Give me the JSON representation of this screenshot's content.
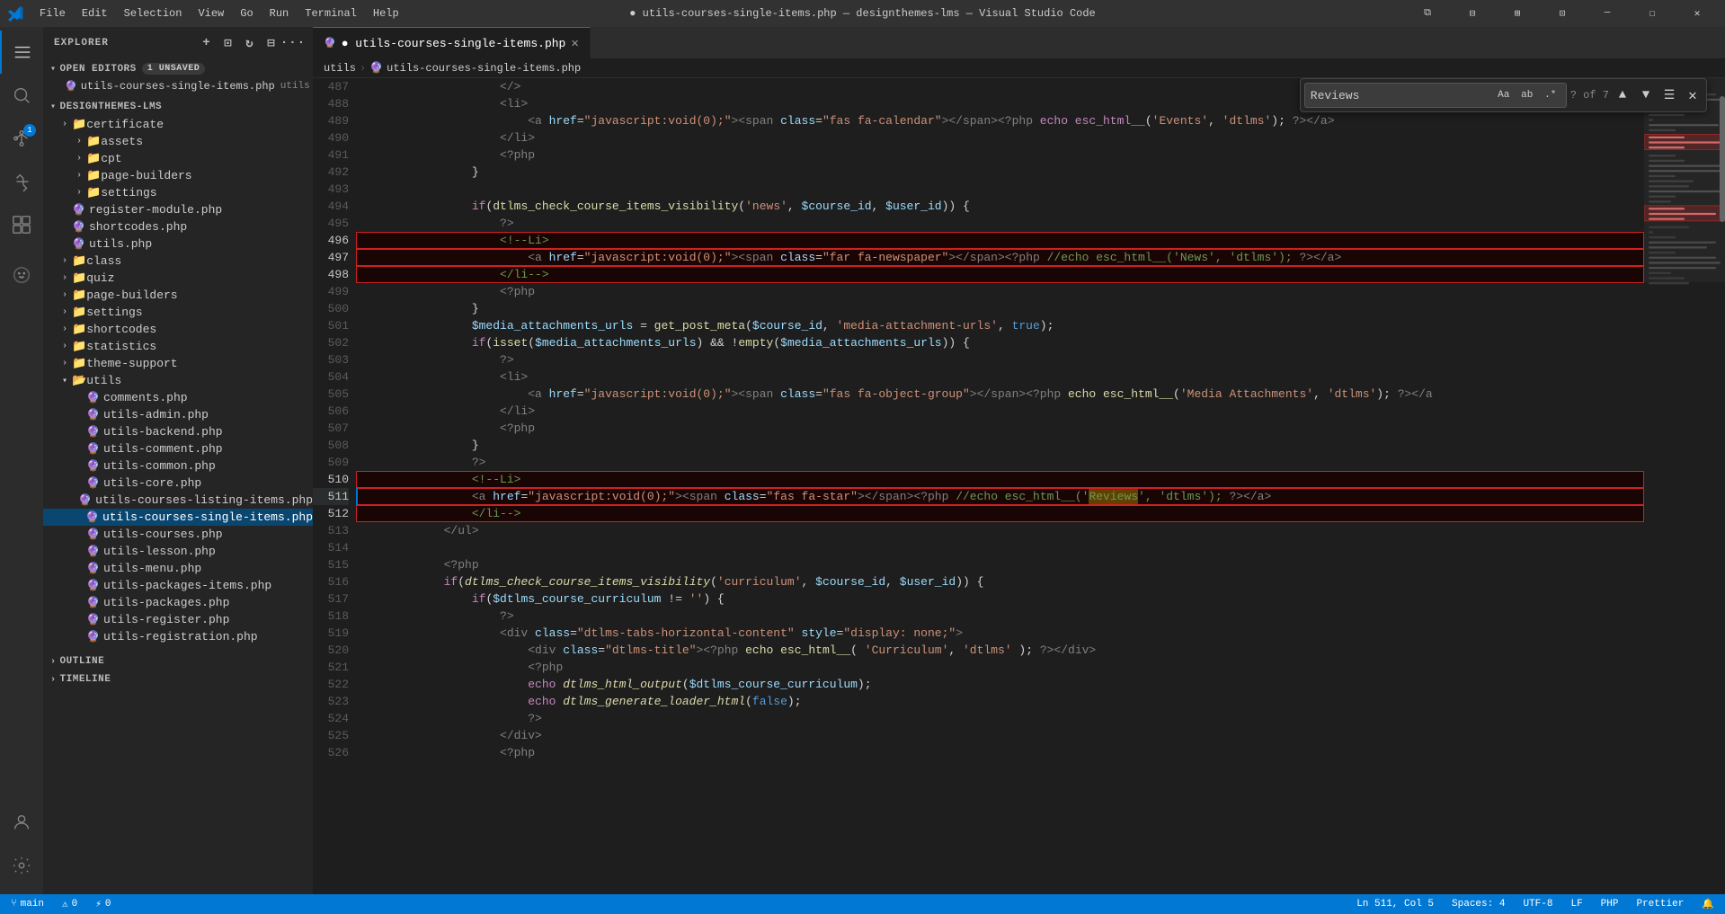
{
  "titleBar": {
    "icon": "⬡",
    "menus": [
      "File",
      "Edit",
      "Selection",
      "View",
      "Go",
      "Run",
      "Terminal",
      "Help"
    ],
    "title": "● utils-courses-single-items.php — designthemes-lms — Visual Studio Code",
    "buttons": [
      "⧉",
      "❐",
      "─",
      "☐",
      "✕"
    ]
  },
  "activityBar": {
    "icons": [
      {
        "name": "search-icon",
        "symbol": "⚲",
        "active": false
      },
      {
        "name": "explorer-icon",
        "symbol": "⧉",
        "active": true
      },
      {
        "name": "source-control-icon",
        "symbol": "⑂",
        "active": false,
        "badge": "1"
      },
      {
        "name": "run-icon",
        "symbol": "▷",
        "active": false
      },
      {
        "name": "extensions-icon",
        "symbol": "⊞",
        "active": false
      },
      {
        "name": "copilot-icon",
        "symbol": "✦",
        "active": false
      }
    ],
    "bottomIcons": [
      {
        "name": "account-icon",
        "symbol": "👤"
      },
      {
        "name": "settings-icon",
        "symbol": "⚙"
      }
    ]
  },
  "sidebar": {
    "title": "Explorer",
    "openEditors": {
      "label": "Open Editors",
      "badge": "1 unsaved",
      "files": [
        {
          "name": "utils-courses-single-items.php",
          "path": "utils",
          "modified": true
        }
      ]
    },
    "explorer": {
      "root": "DESIGNTHEMES-LMS",
      "folders": [
        {
          "name": "certificate",
          "indent": 1
        },
        {
          "name": "assets",
          "indent": 2
        },
        {
          "name": "cpt",
          "indent": 2
        },
        {
          "name": "page-builders",
          "indent": 2
        },
        {
          "name": "settings",
          "indent": 2
        },
        {
          "name": "register-module.php",
          "indent": 1,
          "isFile": true
        },
        {
          "name": "shortcodes.php",
          "indent": 1,
          "isFile": true
        },
        {
          "name": "utils.php",
          "indent": 1,
          "isFile": true
        },
        {
          "name": "class",
          "indent": 1
        },
        {
          "name": "quiz",
          "indent": 1
        },
        {
          "name": "page-builders",
          "indent": 1
        },
        {
          "name": "settings",
          "indent": 1
        },
        {
          "name": "shortcodes",
          "indent": 1
        },
        {
          "name": "statistics",
          "indent": 1
        },
        {
          "name": "theme-support",
          "indent": 1
        },
        {
          "name": "utils",
          "indent": 1,
          "expanded": true
        },
        {
          "name": "comments.php",
          "indent": 2,
          "isFile": true
        },
        {
          "name": "utils-admin.php",
          "indent": 2,
          "isFile": true
        },
        {
          "name": "utils-backend.php",
          "indent": 2,
          "isFile": true
        },
        {
          "name": "utils-comment.php",
          "indent": 2,
          "isFile": true
        },
        {
          "name": "utils-common.php",
          "indent": 2,
          "isFile": true
        },
        {
          "name": "utils-core.php",
          "indent": 2,
          "isFile": true
        },
        {
          "name": "utils-courses-listing-items.php",
          "indent": 2,
          "isFile": true
        },
        {
          "name": "utils-courses-single-items.php",
          "indent": 2,
          "isFile": true,
          "active": true
        },
        {
          "name": "utils-courses.php",
          "indent": 2,
          "isFile": true
        },
        {
          "name": "utils-lesson.php",
          "indent": 2,
          "isFile": true
        },
        {
          "name": "utils-menu.php",
          "indent": 2,
          "isFile": true
        },
        {
          "name": "utils-packages-items.php",
          "indent": 2,
          "isFile": true
        },
        {
          "name": "utils-packages.php",
          "indent": 2,
          "isFile": true
        },
        {
          "name": "utils-register.php",
          "indent": 2,
          "isFile": true
        },
        {
          "name": "utils-registration.php",
          "indent": 2,
          "isFile": true
        }
      ],
      "outline": "OUTLINE",
      "timeline": "TIMELINE"
    }
  },
  "tabs": [
    {
      "label": "utils-courses-single-items.php",
      "modified": true,
      "active": true
    }
  ],
  "breadcrumb": {
    "parts": [
      "utils",
      "›",
      "utils-courses-single-items.php"
    ]
  },
  "findWidget": {
    "value": "Reviews",
    "matchCase": "Aa",
    "matchWord": "ab",
    "regex": ".*",
    "count": "? of 7",
    "navUp": "▲",
    "navDown": "▼",
    "hamburger": "☰",
    "close": "✕"
  },
  "codeLines": [
    {
      "num": 487,
      "content": "                    </>"
    },
    {
      "num": 488,
      "content": "                    <li>"
    },
    {
      "num": 489,
      "content": "                        <a href=\"javascript:void(0);\"><span class=\"fas fa-calendar\"></span><?php echo esc_html__('Events', 'dtlms'); ?></a>"
    },
    {
      "num": 490,
      "content": "                    </li>"
    },
    {
      "num": 491,
      "content": "                    <?php"
    },
    {
      "num": 492,
      "content": "                }"
    },
    {
      "num": 493,
      "content": ""
    },
    {
      "num": 494,
      "content": "                if(dtlms_check_course_items_visibility('news', $course_id, $user_id)) {"
    },
    {
      "num": 495,
      "content": "                    ?>"
    },
    {
      "num": 496,
      "content": "                    <!--Li>"
    },
    {
      "num": 497,
      "content": "                        <a href=\"javascript:void(0);\"><span class=\"far fa-newspaper\"></span><?php //echo esc_html__('News', 'dtlms'); ?></a>"
    },
    {
      "num": 498,
      "content": "                    </li-->"
    },
    {
      "num": 499,
      "content": "                    <?php"
    },
    {
      "num": 500,
      "content": "                }"
    },
    {
      "num": 501,
      "content": "                $media_attachments_urls = get_post_meta($course_id, 'media-attachment-urls', true);"
    },
    {
      "num": 502,
      "content": "                if(isset($media_attachments_urls) && !empty($media_attachments_urls)) {"
    },
    {
      "num": 503,
      "content": "                    ?>"
    },
    {
      "num": 504,
      "content": "                    <li>"
    },
    {
      "num": 505,
      "content": "                        <a href=\"javascript:void(0);\"><span class=\"fas fa-object-group\"></span><?php echo esc_html__('Media Attachments', 'dtlms'); ?></a"
    },
    {
      "num": 506,
      "content": "                    </li>"
    },
    {
      "num": 507,
      "content": "                    <?php"
    },
    {
      "num": 508,
      "content": "                }"
    },
    {
      "num": 509,
      "content": "                ?>"
    },
    {
      "num": 510,
      "content": "                <!--Li>"
    },
    {
      "num": 511,
      "content": "                    <a href=\"javascript:void(0);\"><span class=\"fas fa-star\"></span><?php //echo esc_html__('Reviews', 'dtlms'); ?></a>"
    },
    {
      "num": 512,
      "content": "                </li-->"
    },
    {
      "num": 513,
      "content": "            </ul>"
    },
    {
      "num": 514,
      "content": ""
    },
    {
      "num": 515,
      "content": "            <?php"
    },
    {
      "num": 516,
      "content": "            if(dtlms_check_course_items_visibility('curriculum', $course_id, $user_id)) {"
    },
    {
      "num": 517,
      "content": "                if($dtlms_course_curriculum != '') {"
    },
    {
      "num": 518,
      "content": "                    ?>"
    },
    {
      "num": 519,
      "content": "                    <div class=\"dtlms-tabs-horizontal-content\" style=\"display: none;\">"
    },
    {
      "num": 520,
      "content": "                        <div class=\"dtlms-title\"><?php echo esc_html__( 'Curriculum', 'dtlms' ); ?></div>"
    },
    {
      "num": 521,
      "content": "                        <?php"
    },
    {
      "num": 522,
      "content": "                        echo dtlms_html_output($dtlms_course_curriculum);"
    },
    {
      "num": 523,
      "content": "                        echo dtlms_generate_loader_html(false);"
    },
    {
      "num": 524,
      "content": "                        ?>"
    },
    {
      "num": 525,
      "content": "                    </div>"
    },
    {
      "num": 526,
      "content": "                    <?php"
    }
  ],
  "statusBar": {
    "left": [
      "⑂ main",
      "⚠ 0",
      "⚡ 0"
    ],
    "right": [
      "Ln 511, Col 5",
      "Spaces: 4",
      "UTF-8",
      "LF",
      "PHP",
      "Prettier",
      "⚙"
    ]
  }
}
